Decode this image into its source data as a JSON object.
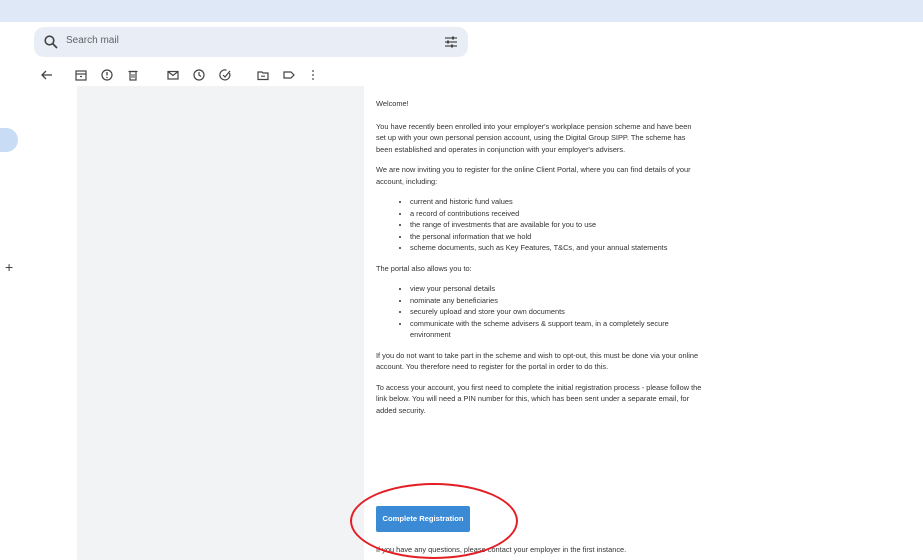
{
  "search": {
    "placeholder": "Search mail"
  },
  "toolbar": {
    "icons": [
      "back-arrow-icon",
      "archive-icon",
      "report-spam-icon",
      "delete-icon",
      "mark-unread-icon",
      "snooze-icon",
      "add-to-tasks-icon",
      "move-to-icon",
      "label-icon",
      "more-options-icon"
    ]
  },
  "email": {
    "p1": "Welcome!",
    "p2": "You have recently been enrolled into your employer's workplace pension scheme and have been set up with your own personal pension account, using the Digital Group SIPP. The scheme has been established and operates in conjunction with your employer's advisers.",
    "p3": "We are now inviting you to register for the online Client Portal, where you can find details of your account, including:",
    "list1": [
      "current and historic fund values",
      "a record of contributions received",
      "the range of investments that are available for you to use",
      "the personal information that we hold",
      "scheme documents, such as Key Features, T&Cs, and your annual statements"
    ],
    "p4": "The portal also allows you to:",
    "list2": [
      "view your personal details",
      "nominate any beneficiaries",
      "securely upload and store your own documents",
      "communicate with the scheme advisers & support team, in a completely secure environment"
    ],
    "p5": "If you do not want to take part in the scheme and wish to opt-out, this must be done via your online account. You therefore need to register for the portal in order to do this.",
    "p6": "To access your account, you first need to complete the initial registration process - please follow the link below. You will need a PIN number for this, which has been sent under a separate email, for added security.",
    "cta_label": "Complete Registration",
    "p7": "If you have any questions, please contact your employer in the first instance."
  },
  "colors": {
    "accent": "#3a8ad6",
    "annotation": "#e31e24",
    "topbar": "#dfe8f7",
    "search_bg": "#e9eef6"
  }
}
